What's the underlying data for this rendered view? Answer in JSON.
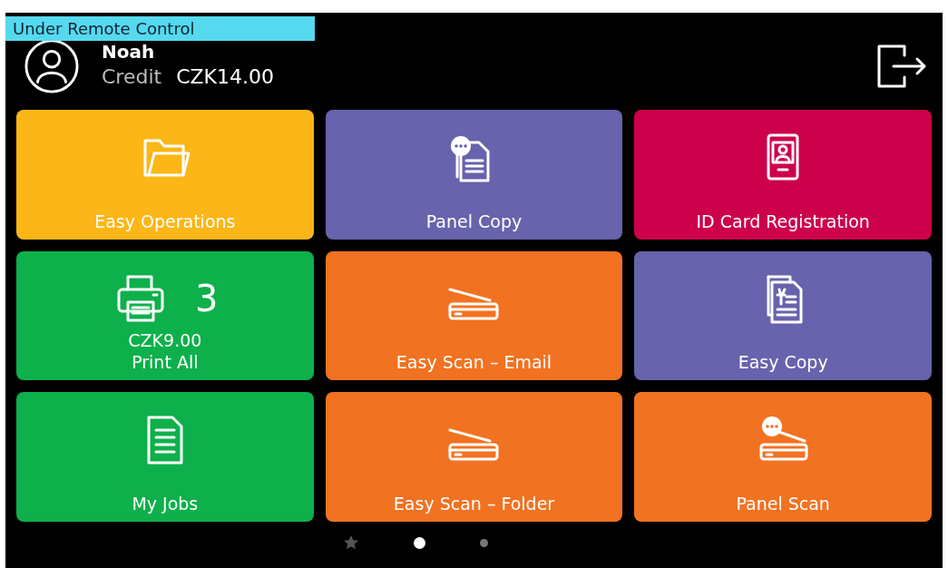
{
  "banner": {
    "text": "Under Remote Control"
  },
  "user": {
    "name": "Noah",
    "credit_label": "Credit",
    "credit_value": "CZK14.00"
  },
  "tiles": [
    {
      "label": "Easy Operations",
      "kind": "folder",
      "color": "#fbb617"
    },
    {
      "label": "Panel Copy",
      "kind": "panelcopy",
      "color": "#6763ac"
    },
    {
      "label": "ID Card Registration",
      "kind": "idcard",
      "color": "#cd004b"
    },
    {
      "label": "Print All",
      "kind": "print",
      "color": "#0db04b",
      "count": "3",
      "amount": "CZK9.00"
    },
    {
      "label": "Easy Scan – Email",
      "kind": "scan",
      "color": "#f17221"
    },
    {
      "label": "Easy Copy",
      "kind": "copy",
      "color": "#6763ac"
    },
    {
      "label": "My Jobs",
      "kind": "jobs",
      "color": "#0db04b"
    },
    {
      "label": "Easy Scan – Folder",
      "kind": "scan",
      "color": "#f17221"
    },
    {
      "label": "Panel Scan",
      "kind": "panelscan",
      "color": "#f17221"
    }
  ],
  "pages": [
    {
      "kind": "star",
      "selected": false
    },
    {
      "kind": "dot",
      "selected": true
    },
    {
      "kind": "dot",
      "selected": false
    }
  ]
}
